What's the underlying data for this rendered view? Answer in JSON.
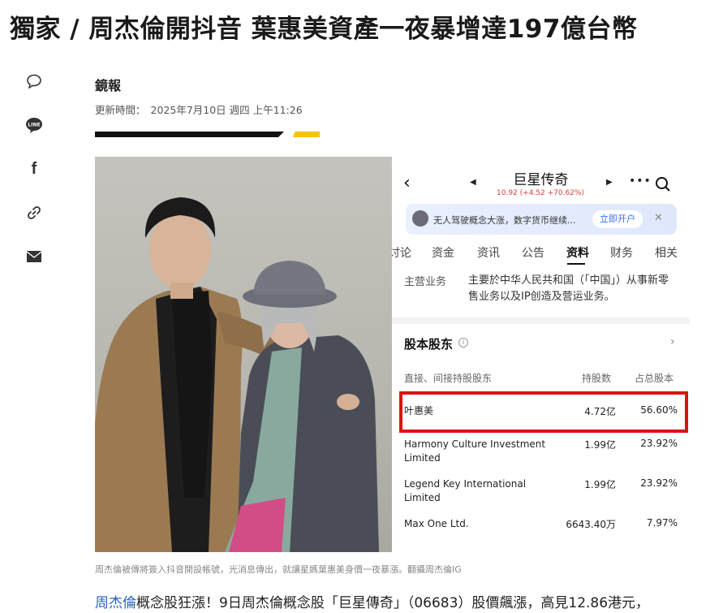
{
  "article": {
    "headline": "獨家 / 周杰倫開抖音 葉惠美資產一夜暴增達197億台幣",
    "source": "鏡報",
    "updated_label": "更新時間：",
    "updated_time": "2025年7月10日 週四 上午11:26",
    "caption": "周杰倫被傳將簽入抖音開設帳號，光消息傳出，就讓星媽葉惠美身價一夜暴漲。翻攝周杰倫IG",
    "body_link": "周杰倫",
    "body_rest": "概念股狂漲！9日周杰倫概念股「巨星傳奇」（06683）股價飆漲，高見12.86港元，"
  },
  "share_icons": [
    "comment-icon",
    "line-icon",
    "facebook-icon",
    "link-icon",
    "mail-icon"
  ],
  "share": {
    "line_label": "LINE",
    "facebook_label": "f"
  },
  "app": {
    "stock_name": "巨星传奇",
    "stock_quote": "10.92 (+4.52 +70.62%)",
    "banner_text": "无人驾驶概念大涨，数字货币继续...",
    "banner_button": "立即开户",
    "tabs": [
      "讨论",
      "资金",
      "资讯",
      "公告",
      "资料",
      "财务",
      "相关"
    ],
    "active_tab": "资料",
    "business_label": "主营业务",
    "business_text": "主要於中华人民共和国（「中国」）从事新零售业务以及IP创造及营运业务。",
    "shareholders_title": "股本股东",
    "columns": {
      "holder": "直接、间接持股股东",
      "shares": "持股数",
      "pct": "占总股本"
    },
    "shareholders": [
      {
        "name": "叶惠美",
        "shares": "4.72亿",
        "pct": "56.60%"
      },
      {
        "name": "Harmony Culture Investment Limited",
        "shares": "1.99亿",
        "pct": "23.92%"
      },
      {
        "name": "Legend Key International Limited",
        "shares": "1.99亿",
        "pct": "23.92%"
      },
      {
        "name": "Max One Ltd.",
        "shares": "6643.40万",
        "pct": "7.97%"
      }
    ],
    "colors": {
      "quote_up": "#e23b3b",
      "highlight_border": "#e01010",
      "accent_blue": "#3a6ee8"
    }
  },
  "colors": {
    "rule_black": "#111111",
    "rule_yellow": "#f5c400",
    "link_blue": "#2a66b8"
  }
}
